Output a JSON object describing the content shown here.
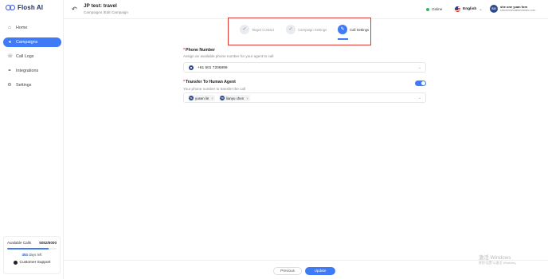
{
  "app": {
    "logo_text": "Flosh AI"
  },
  "sidebar": {
    "items": [
      {
        "label": "Home",
        "icon": "home-icon",
        "active": false
      },
      {
        "label": "Campaigns",
        "icon": "megaphone-icon",
        "active": true
      },
      {
        "label": "Call Logs",
        "icon": "call-log-icon",
        "active": false
      },
      {
        "label": "Integrations",
        "icon": "integrations-icon",
        "active": false
      },
      {
        "label": "Settings",
        "icon": "gear-icon",
        "active": false
      }
    ],
    "calls": {
      "label": "Available Calls",
      "value": "5052/6000",
      "days_value": "454",
      "days_label": "days left",
      "support_label": "Customer Support",
      "progress": 0.84
    }
  },
  "header": {
    "title": "JP test: travel",
    "subtitle": "Campaigns /Edit Campaign",
    "status": "Online",
    "language": "English",
    "avatar_initials": "SO",
    "user_name": "she one yuan fom",
    "user_email": "sheoneeahoaifahnfaninc.com"
  },
  "stepper": {
    "steps": [
      {
        "label": "Target Contact",
        "state": "done"
      },
      {
        "label": "Campaign Settings",
        "state": "done"
      },
      {
        "label": "Call Settings",
        "state": "active"
      }
    ]
  },
  "form": {
    "phone": {
      "label": "Phone Number",
      "hint": "Assign an available phone number for your agent to call",
      "value": "+61 501 7206898"
    },
    "transfer": {
      "label": "Transfer To Human Agent",
      "hint": "Your phone number to transfer the call",
      "enabled": true,
      "agents": [
        {
          "initials": "YL",
          "name": "yusen lin"
        },
        {
          "initials": "TC",
          "name": "lianyu chen"
        }
      ]
    }
  },
  "footer": {
    "previous_label": "Previous",
    "update_label": "Update"
  },
  "watermark": {
    "line1": "激活 Windows",
    "line2": "转到\"设置\"以激活 Windows。"
  },
  "colors": {
    "accent": "#3f7bf6",
    "danger": "#e53935",
    "online": "#2eb85c"
  }
}
